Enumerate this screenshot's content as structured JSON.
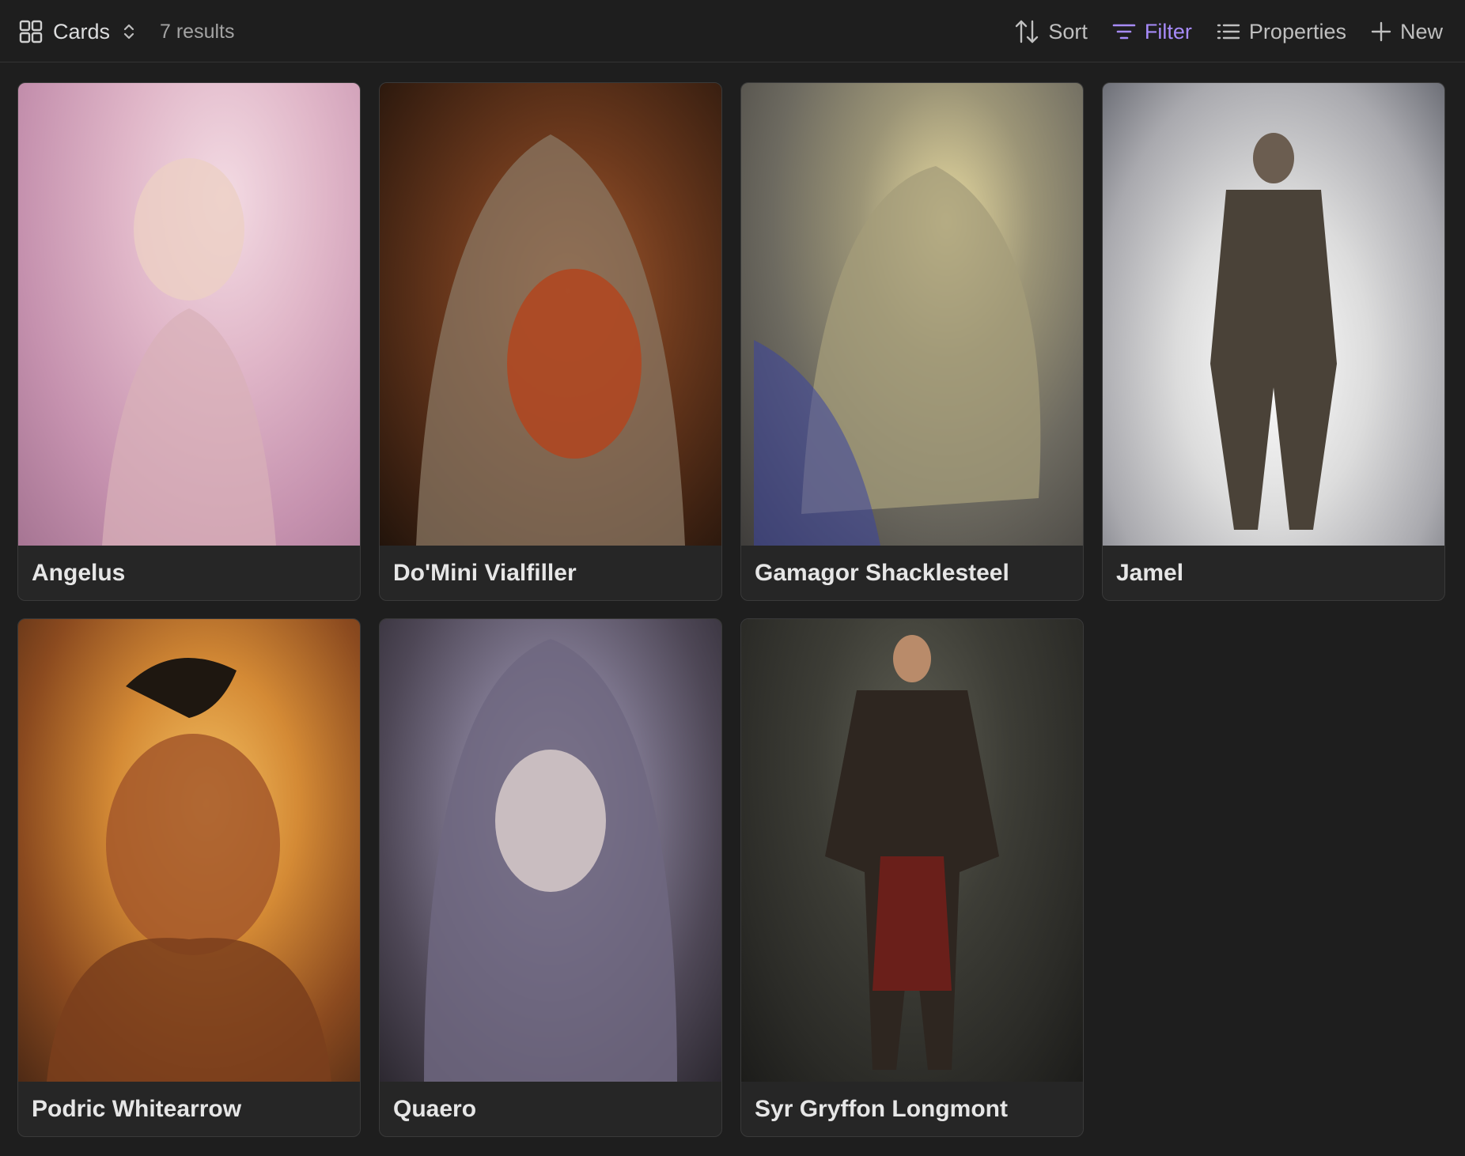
{
  "toolbar": {
    "view_label": "Cards",
    "result_count": "7 results",
    "actions": {
      "sort": "Sort",
      "filter": "Filter",
      "properties": "Properties",
      "new": "New"
    },
    "active_color": "#a78bfa"
  },
  "cards": [
    {
      "title": "Angelus"
    },
    {
      "title": "Do'Mini Vialfiller"
    },
    {
      "title": "Gamagor Shacklesteel"
    },
    {
      "title": "Jamel"
    },
    {
      "title": "Podric Whitearrow"
    },
    {
      "title": "Quaero"
    },
    {
      "title": "Syr Gryffon Longmont"
    }
  ]
}
